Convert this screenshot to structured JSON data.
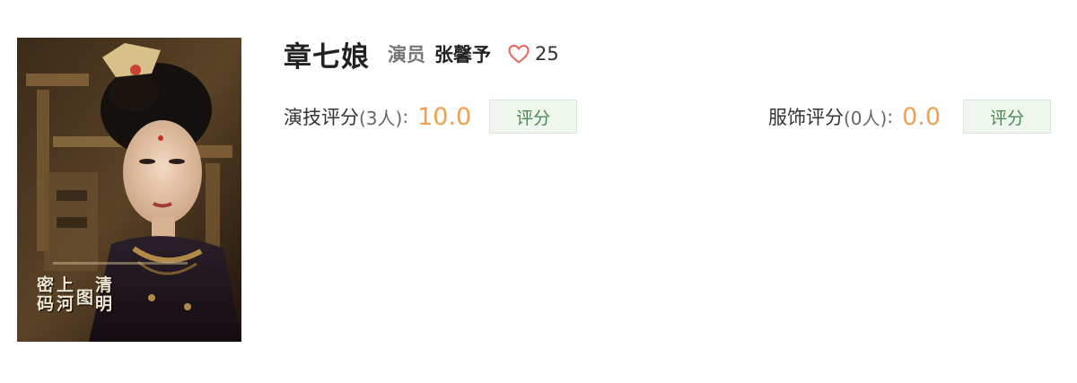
{
  "character": {
    "name": "章七娘",
    "actor_label": "演员",
    "actor_name": "张馨予",
    "like_icon": "heart-outline-icon",
    "likes": "25"
  },
  "poster": {
    "alt": "poster image",
    "title_chars": [
      "密",
      "码",
      "上",
      "河",
      "图",
      "清",
      "明"
    ]
  },
  "ratings": {
    "acting": {
      "label": "演技评分",
      "count": "(3人)",
      "colon": ":",
      "score": "10.0",
      "button": "评分"
    },
    "costume": {
      "label": "服饰评分",
      "count": "(0人)",
      "colon": ":",
      "score": "0.0",
      "button": "评分"
    }
  },
  "colors": {
    "score": "#f0a050",
    "heart": "#e8645c",
    "button_bg": "#eef6ee",
    "button_text": "#4c8a52"
  }
}
